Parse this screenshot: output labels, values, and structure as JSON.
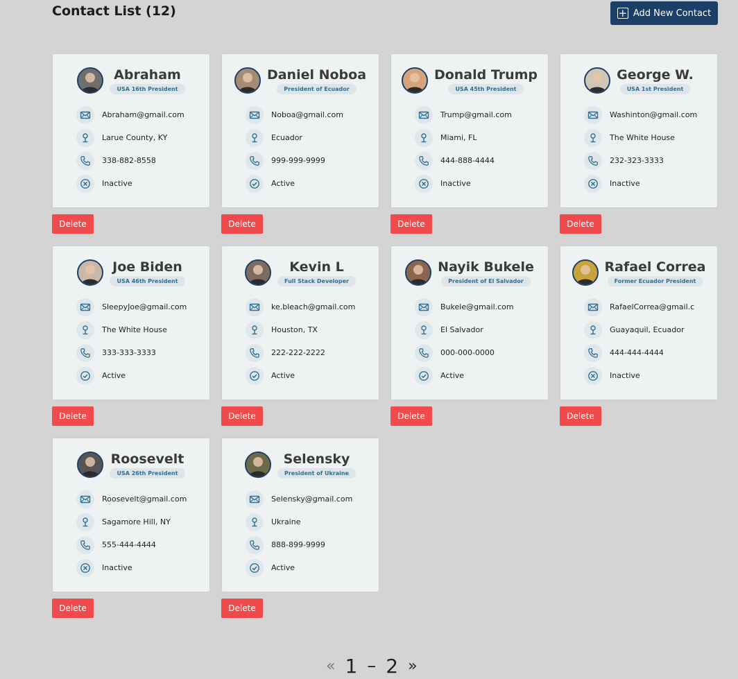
{
  "header": {
    "title": "Contact List (12)",
    "add_button": {
      "label": "Add New Contact",
      "icon": "plus-square-icon"
    }
  },
  "colors": {
    "background": "#d4d4d4",
    "card": "#eef2f3",
    "primary": "#1b3f66",
    "badge_text": "#2f6f95",
    "delete": "#f04a4c"
  },
  "contacts": [
    {
      "name": "Abraham",
      "title": "USA 16th President",
      "email": "Abraham@gmail.com",
      "address": "Larue County, KY",
      "phone": "338-882-8558",
      "status": "Inactive",
      "avatar": "#6f6f6f"
    },
    {
      "name": "Daniel Noboa",
      "title": "President of Ecuador",
      "email": "Noboa@gmail.com",
      "address": "Ecuador",
      "phone": "999-999-9999",
      "status": "Active",
      "avatar": "#a58a74"
    },
    {
      "name": "Donald Trump",
      "title": "USA 45th President",
      "email": "Trump@gmail.com",
      "address": "Miami, FL",
      "phone": "444-888-4444",
      "status": "Inactive",
      "avatar": "#d7a37d"
    },
    {
      "name": "George W.",
      "title": "USA 1st President",
      "email": "Washinton@gmail.com",
      "address": "The White House",
      "phone": "232-323-3333",
      "status": "Inactive",
      "avatar": "#cfc6b6"
    },
    {
      "name": "Joe Biden",
      "title": "USA 46th President",
      "email": "SleepyJoe@gmail.com",
      "address": "The White House",
      "phone": "333-333-3333",
      "status": "Active",
      "avatar": "#c9b8a8"
    },
    {
      "name": "Kevin L",
      "title": "Full Stack Developer",
      "email": "ke.bleach@gmail.com",
      "address": "Houston, TX",
      "phone": "222-222-2222",
      "status": "Active",
      "avatar": "#7d6b62"
    },
    {
      "name": "Nayik Bukele",
      "title": "President of El Salvador",
      "email": "Bukele@gmail.com",
      "address": "El Salvador",
      "phone": "000-000-0000",
      "status": "Active",
      "avatar": "#8a6651"
    },
    {
      "name": "Rafael Correa",
      "title": "Former Ecuador President",
      "email": "RafaelCorrea@gmail.c",
      "address": "Guayaquil, Ecuador",
      "phone": "444-444-4444",
      "status": "Inactive",
      "avatar": "#c9a23a"
    },
    {
      "name": "Roosevelt",
      "title": "USA 26th President",
      "email": "Roosevelt@gmail.com",
      "address": "Sagamore Hill, NY",
      "phone": "555-444-4444",
      "status": "Inactive",
      "avatar": "#555555"
    },
    {
      "name": "Selensky",
      "title": "President of Ukraine",
      "email": "Selensky@gmail.com",
      "address": "Ukraine",
      "phone": "888-899-9999",
      "status": "Active",
      "avatar": "#6b6a4a"
    }
  ],
  "delete_label": "Delete",
  "icons": {
    "email": "envelope-icon",
    "address": "map-pin-icon",
    "phone": "phone-icon",
    "active": "check-circle-icon",
    "inactive": "x-circle-icon"
  },
  "pagination": {
    "prev": "«",
    "page1": "1",
    "separator": "–",
    "page2": "2",
    "next": "»"
  }
}
